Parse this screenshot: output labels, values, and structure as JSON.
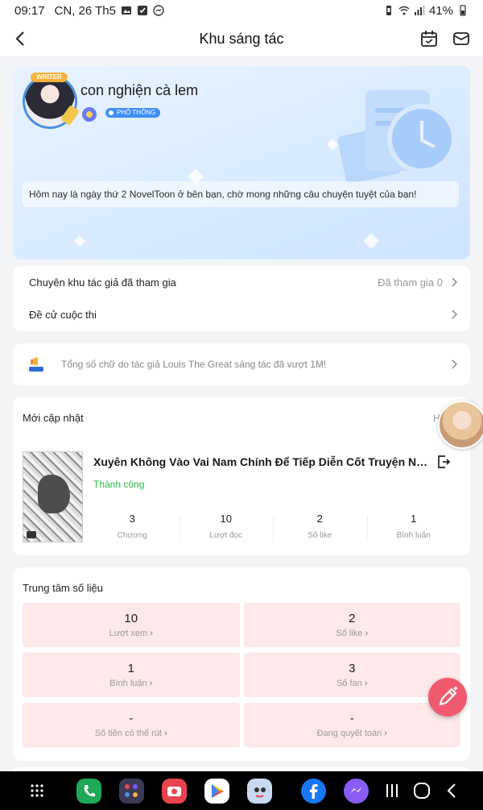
{
  "status_bar": {
    "time": "09:17",
    "date": "CN, 26 Th5",
    "battery": "41%"
  },
  "header": {
    "title": "Khu sáng tác"
  },
  "profile": {
    "writer_tag": "WRITER",
    "username": "con nghiện cà lem",
    "level_badge": "PHỔ THÔNG",
    "welcome": "Hôm nay là ngày thứ 2 NovelToon ở bên bạn, chờ mong những câu chuyện tuyệt của bạn!"
  },
  "menu": {
    "items": [
      {
        "label": "Chuyên khu tác giả đã tham gia",
        "meta": "Đã tham gia 0"
      },
      {
        "label": "Đề cử cuộc thi",
        "meta": ""
      }
    ]
  },
  "notice": {
    "text": "Tổng số chữ do tác giả Louis The Great sáng tác đã vượt 1M!"
  },
  "latest": {
    "title": "Mới cập nhật",
    "peek_text": "H",
    "novel": {
      "title": "Xuyên Không Vào Vai Nam Chính Để Tiếp Diễn Cốt Truyện Nhưn...",
      "status": "Thành công",
      "stats": [
        {
          "value": "3",
          "label": "Chương"
        },
        {
          "value": "10",
          "label": "Lượt đọc"
        },
        {
          "value": "2",
          "label": "Số like"
        },
        {
          "value": "1",
          "label": "Bình luận"
        }
      ]
    }
  },
  "data_center": {
    "title": "Trung tâm số liệu",
    "cells": [
      {
        "value": "10",
        "label": "Lượt xem"
      },
      {
        "value": "2",
        "label": "Số like"
      },
      {
        "value": "1",
        "label": "Bình luận"
      },
      {
        "value": "3",
        "label": "Số fan"
      },
      {
        "value": "-",
        "label": "Số tiền có thể rút"
      },
      {
        "value": "-",
        "label": "Đang quyết toán"
      }
    ]
  },
  "colors": {
    "accent": "#3e8ef7",
    "success": "#2fb34a",
    "data_cell_bg": "#fde8ea",
    "fab": "#ef5a6f"
  },
  "icons": {
    "back": "chevron-left-icon",
    "calendar": "calendar-icon",
    "mail": "mail-icon",
    "export": "export-icon",
    "fab": "pen-icon"
  }
}
